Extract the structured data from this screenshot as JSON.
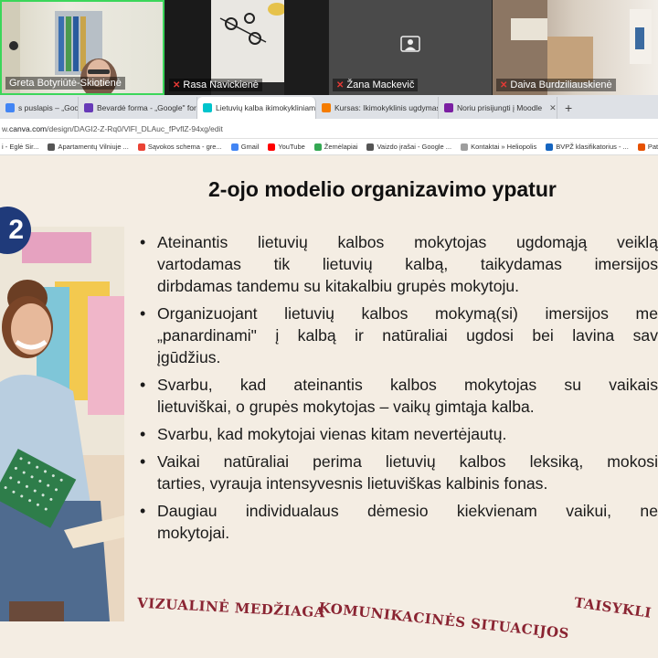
{
  "participants": [
    {
      "name": "Greta Botyriūtė-Skiotienė",
      "muted": false
    },
    {
      "name": "Rasa Navickienė",
      "muted": true
    },
    {
      "name": "Žana Mackevič",
      "muted": true
    },
    {
      "name": "Daiva Burdziliauskienė",
      "muted": true
    }
  ],
  "tabs": [
    {
      "label": "s puslapis – „Google",
      "color": "#4285f4",
      "active": false
    },
    {
      "label": "Bevardė forma - „Google\" form",
      "color": "#673ab7",
      "active": false
    },
    {
      "label": "Lietuvių kalba ikimokykliniame",
      "color": "#00c4cc",
      "active": true
    },
    {
      "label": "Kursas: Ikimokyklinis ugdymas (",
      "color": "#f57c00",
      "active": false
    },
    {
      "label": "Noriu prisijungti į Moodle",
      "color": "#7b1fa2",
      "active": false
    }
  ],
  "url": {
    "prefix": "w.",
    "host": "canva.com",
    "path": "/design/DAGI2-Z-Rq0/VlFl_DLAuc_fPvflZ-94xg/edit"
  },
  "bookmarks": [
    {
      "label": "i - Eglė Sir...",
      "color": "#34a853"
    },
    {
      "label": "Apartamentų Vilniuje ...",
      "color": "#555555"
    },
    {
      "label": "Sąvokos schema - gre...",
      "color": "#ea4335"
    },
    {
      "label": "Gmail",
      "color": "#4285f4"
    },
    {
      "label": "YouTube",
      "color": "#ff0000"
    },
    {
      "label": "Žemėlapiai",
      "color": "#34a853"
    },
    {
      "label": "Vaizdo įrašai - Google ...",
      "color": "#555555"
    },
    {
      "label": "Kontaktai » Heliopolis",
      "color": "#9e9e9e"
    },
    {
      "label": "BVPŽ klasifikatorius - ...",
      "color": "#1565c0"
    },
    {
      "label": "Patvirtinti užsakyr",
      "color": "#e65100"
    }
  ],
  "slide": {
    "title": "2-ojo modelio organizavimo ypatur",
    "number": "2",
    "bullets": [
      [
        "Ateinantis lietuvių kalbos mokytojas ugdomąją veiklą",
        "vartodamas tik lietuvių kalbą, taikydamas imersijos",
        "dirbdamas tandemu su kitakalbiu grupės mokytoju."
      ],
      [
        "Organizuojant lietuvių kalbos mokymą(si) imersijos me",
        "„panardinami\" į kalbą ir natūraliai ugdosi bei lavina sav",
        "įgūdžius."
      ],
      [
        "Svarbu, kad ateinantis kalbos mokytojas su vaikais",
        "lietuviškai, o grupės mokytojas – vaikų gimtąja kalba."
      ],
      [
        "Svarbu, kad mokytojai vienas kitam nevertėjautų."
      ],
      [
        "Vaikai natūraliai perima lietuvių kalbos leksiką, mokosi",
        "tarties, vyrauja intensyvesnis lietuviškas kalbinis fonas."
      ],
      [
        "Daugiau individualaus dėmesio kiekvienam vaikui, ne",
        "mokytojai."
      ]
    ],
    "tags": [
      "VIZUALINĖ MEDŽIAGA",
      "KOMUNIKACINĖS SITUACIJOS",
      "TAISYKLI"
    ]
  },
  "colors": {
    "slide_bg": "#f4ede3",
    "badge": "#1f3a7a",
    "tag_text": "#8a2432"
  }
}
